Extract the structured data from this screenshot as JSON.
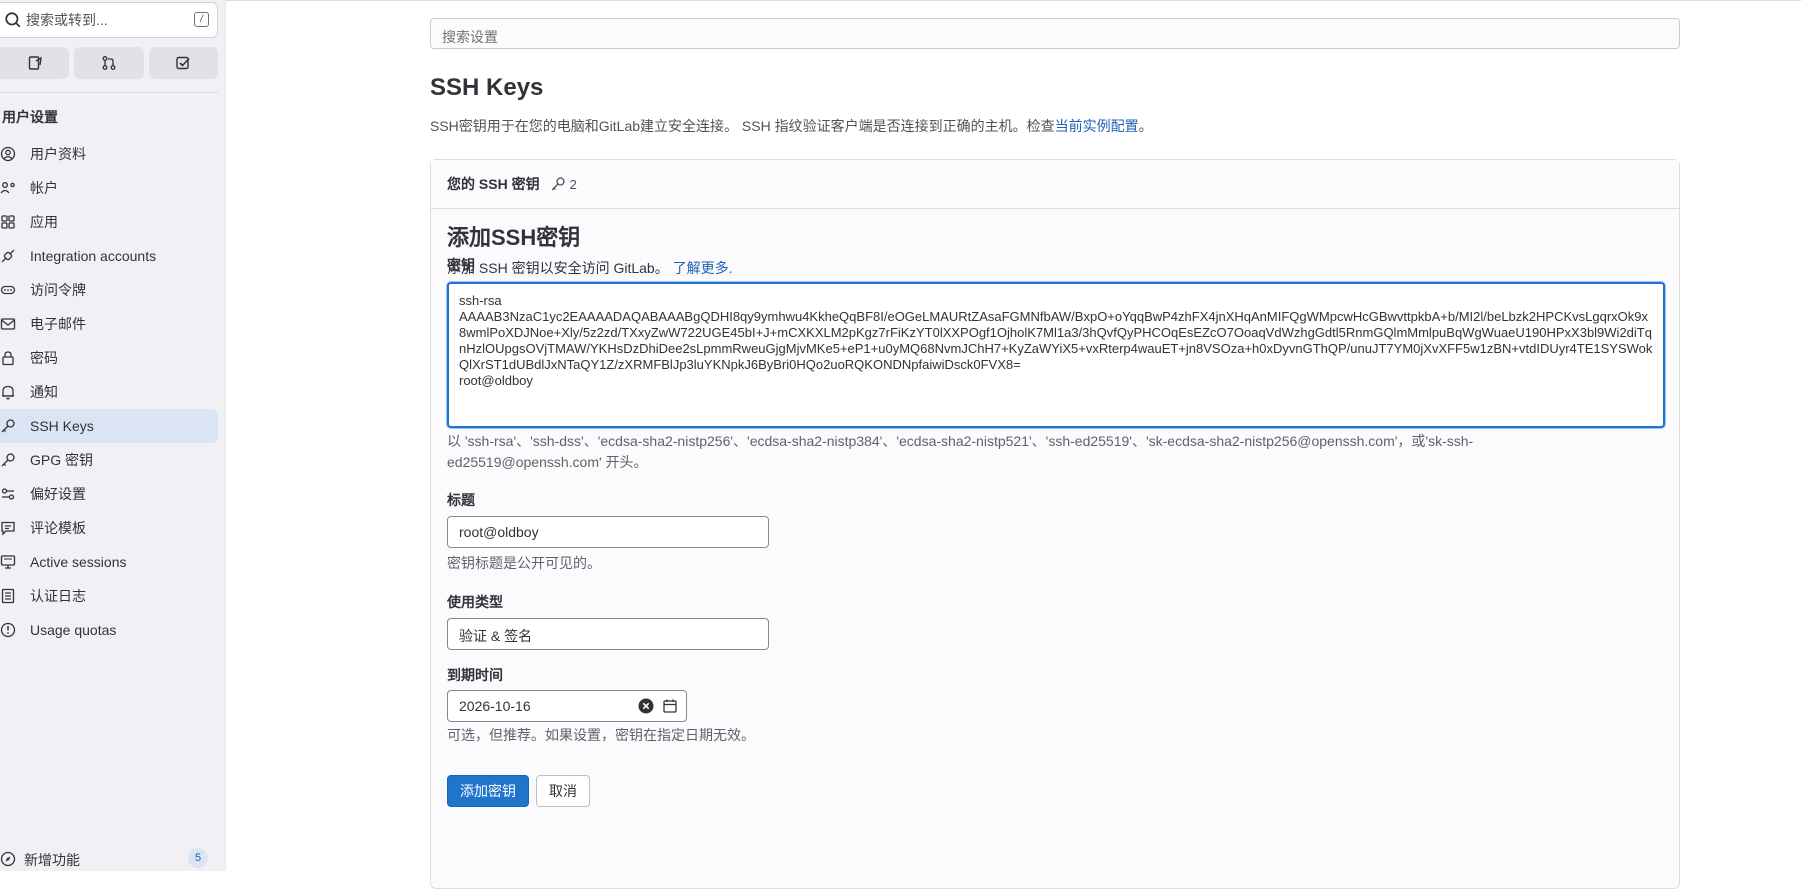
{
  "sidebar": {
    "search_placeholder": "搜索或转到...",
    "shortcut_key": "/",
    "quick_buttons": [
      {
        "icon": "issues-icon"
      },
      {
        "icon": "merge-request-icon"
      },
      {
        "icon": "todo-icon"
      }
    ],
    "section_title": "用户设置",
    "items": [
      {
        "label": "用户资料",
        "icon": "profile-icon"
      },
      {
        "label": "帐户",
        "icon": "account-icon"
      },
      {
        "label": "应用",
        "icon": "applications-icon"
      },
      {
        "label": "Integration accounts",
        "icon": "integration-icon"
      },
      {
        "label": "访问令牌",
        "icon": "token-icon"
      },
      {
        "label": "电子邮件",
        "icon": "mail-icon"
      },
      {
        "label": "密码",
        "icon": "lock-icon"
      },
      {
        "label": "通知",
        "icon": "bell-icon"
      },
      {
        "label": "SSH Keys",
        "icon": "key-icon",
        "active": true
      },
      {
        "label": "GPG 密钥",
        "icon": "key-icon"
      },
      {
        "label": "偏好设置",
        "icon": "preferences-icon"
      },
      {
        "label": "评论模板",
        "icon": "comment-icon"
      },
      {
        "label": "Active sessions",
        "icon": "monitor-icon"
      },
      {
        "label": "认证日志",
        "icon": "log-icon"
      },
      {
        "label": "Usage quotas",
        "icon": "quota-icon"
      }
    ],
    "whats_new": {
      "label": "新增功能",
      "count": "5"
    }
  },
  "main": {
    "settings_search_placeholder": "搜索设置",
    "title": "SSH Keys",
    "desc_text": "SSH密钥用于在您的电脑和GitLab建立安全连接。 SSH 指纹验证客户端是否连接到正确的主机。检查",
    "desc_link": "当前实例配置",
    "desc_end": "。",
    "card": {
      "header": "您的 SSH 密钥",
      "key_count": "2",
      "form_title": "添加SSH密钥",
      "form_desc": "添加 SSH 密钥以安全访问 GitLab。",
      "learn_more": "了解更多.",
      "key_label": "密钥",
      "key_value": "ssh-rsa\nAAAAB3NzaC1yc2EAAAADAQABAAABgQDHI8qy9ymhwu4KkheQqBF8I/eOGeLMAURtZAsaFGMNfbAW/BxpO+oYqqBwP4zhFX4jnXHqAnMIFQgWMpcwHcGBwvttpkbA+b/MI2l/beLbzk2HPCKvsLgqrxOk9x8wmlPoXDJNoe+Xly/5z2zd/TXxyZwW722UGE45bI+J+mCXKXLM2pKgz7rFiKzYT0lXXPOgf1OjholK7Ml1a3/3hQvfQyPHCOqEsEZcO7OoaqVdWzhgGdtl5RnmGQlmMmlpuBqWgWuaeU190HPxX3bl9Wi2diTqnHzlOUpgsOVjTMAW/YKHsDzDhiDee2sLpmmRweuGjgMjvMKe5+eP1+u0yMQ68NvmJChH7+KyZaWYiX5+vxRterp4wauET+jn8VSOza+h0xDyvnGThQP/unuJT7YM0jXvXFF5w1zBN+vtdIDUyr4TE1SYSWokQlXrST1dUBdlJxNTaQY1Z/zXRMFBlJp3luYKNpkJ6ByBri0HQo2uoRQKONDNpfaiwiDsck0FVX8=\nroot@oldboy",
      "key_help_1": "以 'ssh-rsa'、'ssh-dss'、'ecdsa-sha2-nistp256'、'ecdsa-sha2-nistp384'、'ecdsa-sha2-nistp521'、'ssh-ed25519'、'sk-ecdsa-sha2-nistp256@openssh.com'，或'sk-ssh-",
      "key_help_2": "ed25519@openssh.com' 开头。",
      "title_label": "标题",
      "title_value": "root@oldboy",
      "title_help": "密钥标题是公开可见的。",
      "usage_label": "使用类型",
      "usage_value": "验证 & 签名",
      "expiry_label": "到期时间",
      "expiry_value": "2026-10-16",
      "expiry_help": "可选，但推荐。如果设置，密钥在指定日期无效。",
      "add_button": "添加密钥",
      "cancel_button": "取消"
    }
  },
  "colors": {
    "primary": "#1f75cb",
    "link": "#1f5fb4",
    "sidebar_bg": "#f1f1f5",
    "active_bg": "#dbe4f2"
  }
}
